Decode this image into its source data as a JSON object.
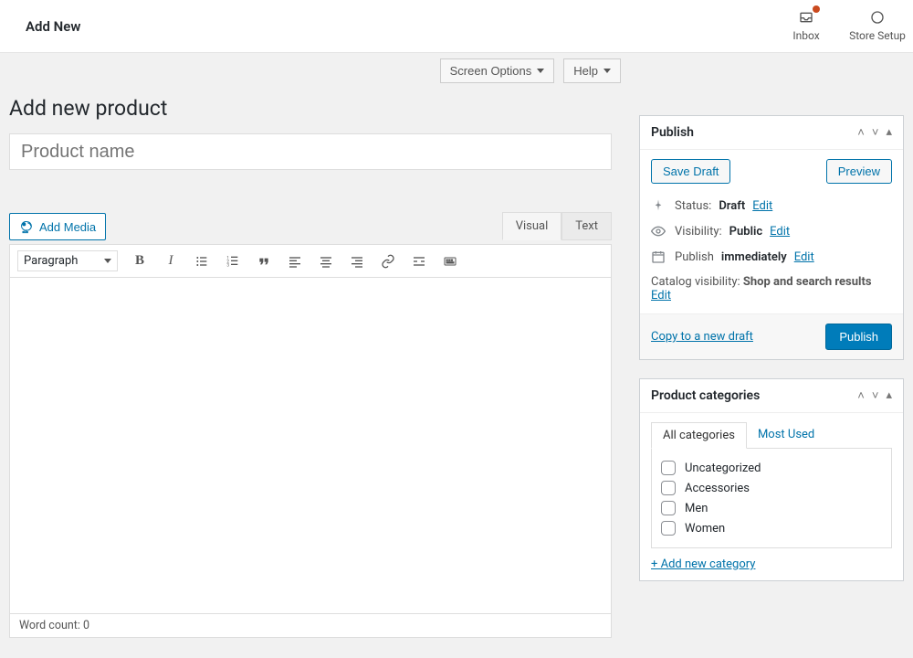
{
  "topbar": {
    "title": "Add New",
    "inbox": "Inbox",
    "store_setup": "Store Setup"
  },
  "toprow": {
    "screen_options": "Screen Options",
    "help": "Help"
  },
  "page": {
    "heading": "Add new product",
    "title_placeholder": "Product name"
  },
  "editor": {
    "add_media": "Add Media",
    "tab_visual": "Visual",
    "tab_text": "Text",
    "format_label": "Paragraph",
    "word_count": "Word count: 0"
  },
  "publish": {
    "title": "Publish",
    "save_draft": "Save Draft",
    "preview": "Preview",
    "status_label": "Status:",
    "status_value": "Draft",
    "visibility_label": "Visibility:",
    "visibility_value": "Public",
    "schedule_label": "Publish",
    "schedule_value": "immediately",
    "catalog_label": "Catalog visibility:",
    "catalog_value": "Shop and search results",
    "edit": "Edit",
    "copy": "Copy to a new draft",
    "publish_btn": "Publish"
  },
  "categories": {
    "title": "Product categories",
    "tab_all": "All categories",
    "tab_most": "Most Used",
    "items": [
      {
        "label": "Uncategorized"
      },
      {
        "label": "Accessories"
      },
      {
        "label": "Men"
      },
      {
        "label": "Women"
      }
    ],
    "add_new": "+ Add new category"
  }
}
